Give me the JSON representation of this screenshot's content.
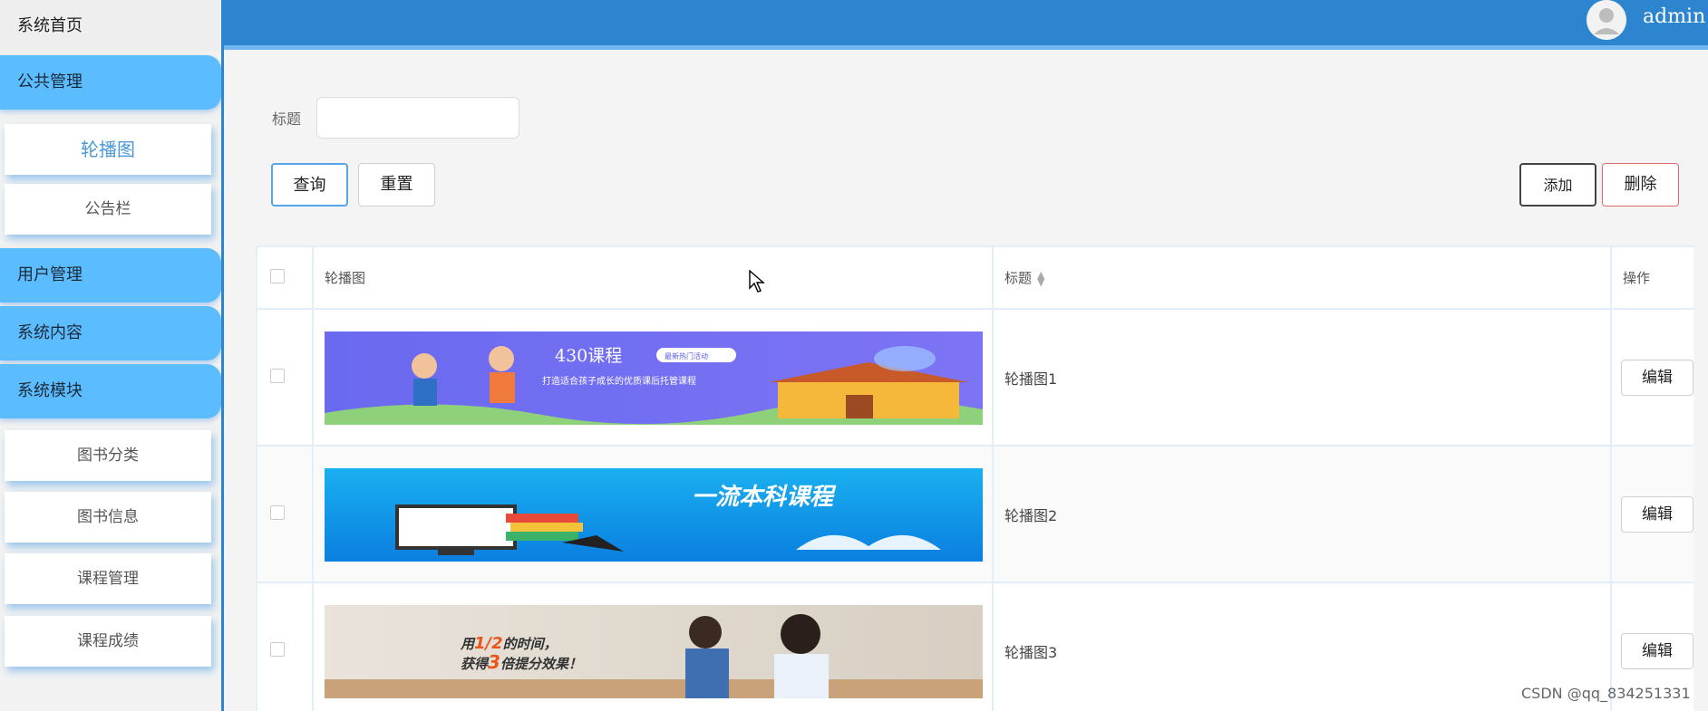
{
  "sidebar": {
    "home": "系统首页",
    "groups": [
      {
        "label": "公共管理",
        "items": [
          "轮播图",
          "公告栏"
        ]
      },
      {
        "label": "用户管理",
        "items": []
      },
      {
        "label": "系统内容",
        "items": []
      },
      {
        "label": "系统模块",
        "items": [
          "图书分类",
          "图书信息",
          "课程管理",
          "课程成绩"
        ]
      }
    ]
  },
  "header": {
    "username": "admin"
  },
  "search": {
    "label": "标题",
    "value": "",
    "placeholder": ""
  },
  "buttons": {
    "query": "查询",
    "reset": "重置",
    "add": "添加",
    "delete": "删除"
  },
  "table": {
    "headers": {
      "image": "轮播图",
      "title": "标题",
      "actions": "操作"
    },
    "rows": [
      {
        "title": "轮播图1",
        "edit": "编辑",
        "banner": {
          "headline": "430课程",
          "badge": "最新热门活动",
          "sub": "打造适合孩子成长的优质课后托管课程"
        }
      },
      {
        "title": "轮播图2",
        "edit": "编辑",
        "banner": {
          "headline": "一流本科课程"
        }
      },
      {
        "title": "轮播图3",
        "edit": "编辑",
        "banner": {
          "line1_a": "用",
          "line1_b": "1/2",
          "line1_c": "的时间，",
          "line2_a": "获得",
          "line2_b": "3",
          "line2_c": "倍提分效果！"
        }
      }
    ]
  },
  "watermark": "CSDN @qq_834251331",
  "colors": {
    "header": "#2d85cf",
    "sidebar_group": "#5bbcff",
    "active_sub": "#4a98d9",
    "delete_border": "#e06a6a"
  }
}
